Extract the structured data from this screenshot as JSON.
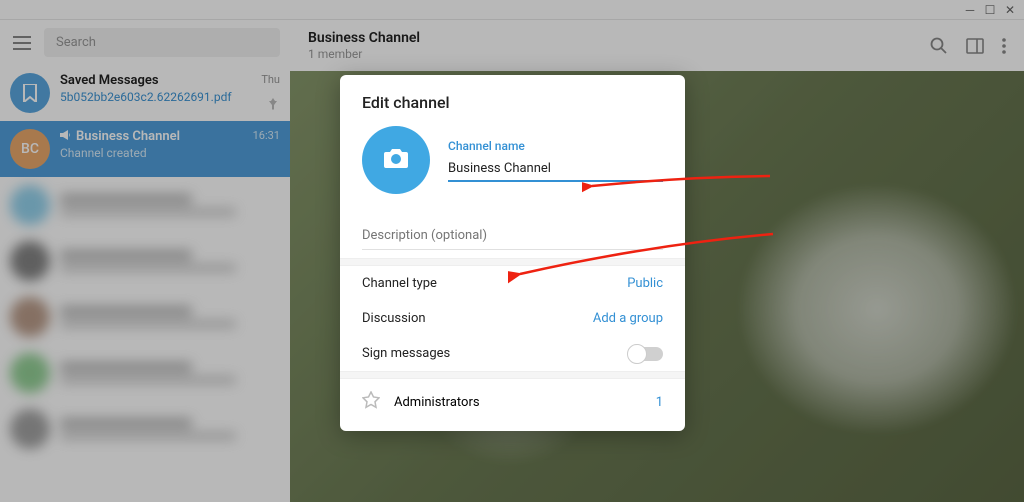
{
  "window": {
    "minimize": "─",
    "maximize": "☐",
    "close": "✕"
  },
  "sidebar": {
    "search_placeholder": "Search",
    "items": [
      {
        "name": "Saved Messages",
        "sub": "5b052bb2e603c2.62262691.pdf",
        "time": "Thu"
      },
      {
        "name": "Business Channel",
        "sub": "Channel created",
        "time": "16:31",
        "avatar_text": "BC"
      }
    ]
  },
  "header": {
    "title": "Business Channel",
    "subtitle": "1 member"
  },
  "dialog": {
    "title": "Edit channel",
    "name_label": "Channel name",
    "name_value": "Business Channel",
    "desc_placeholder": "Description (optional)",
    "channel_type_label": "Channel type",
    "channel_type_value": "Public",
    "discussion_label": "Discussion",
    "discussion_value": "Add a group",
    "sign_label": "Sign messages",
    "admins_label": "Administrators",
    "admins_count": "1"
  }
}
